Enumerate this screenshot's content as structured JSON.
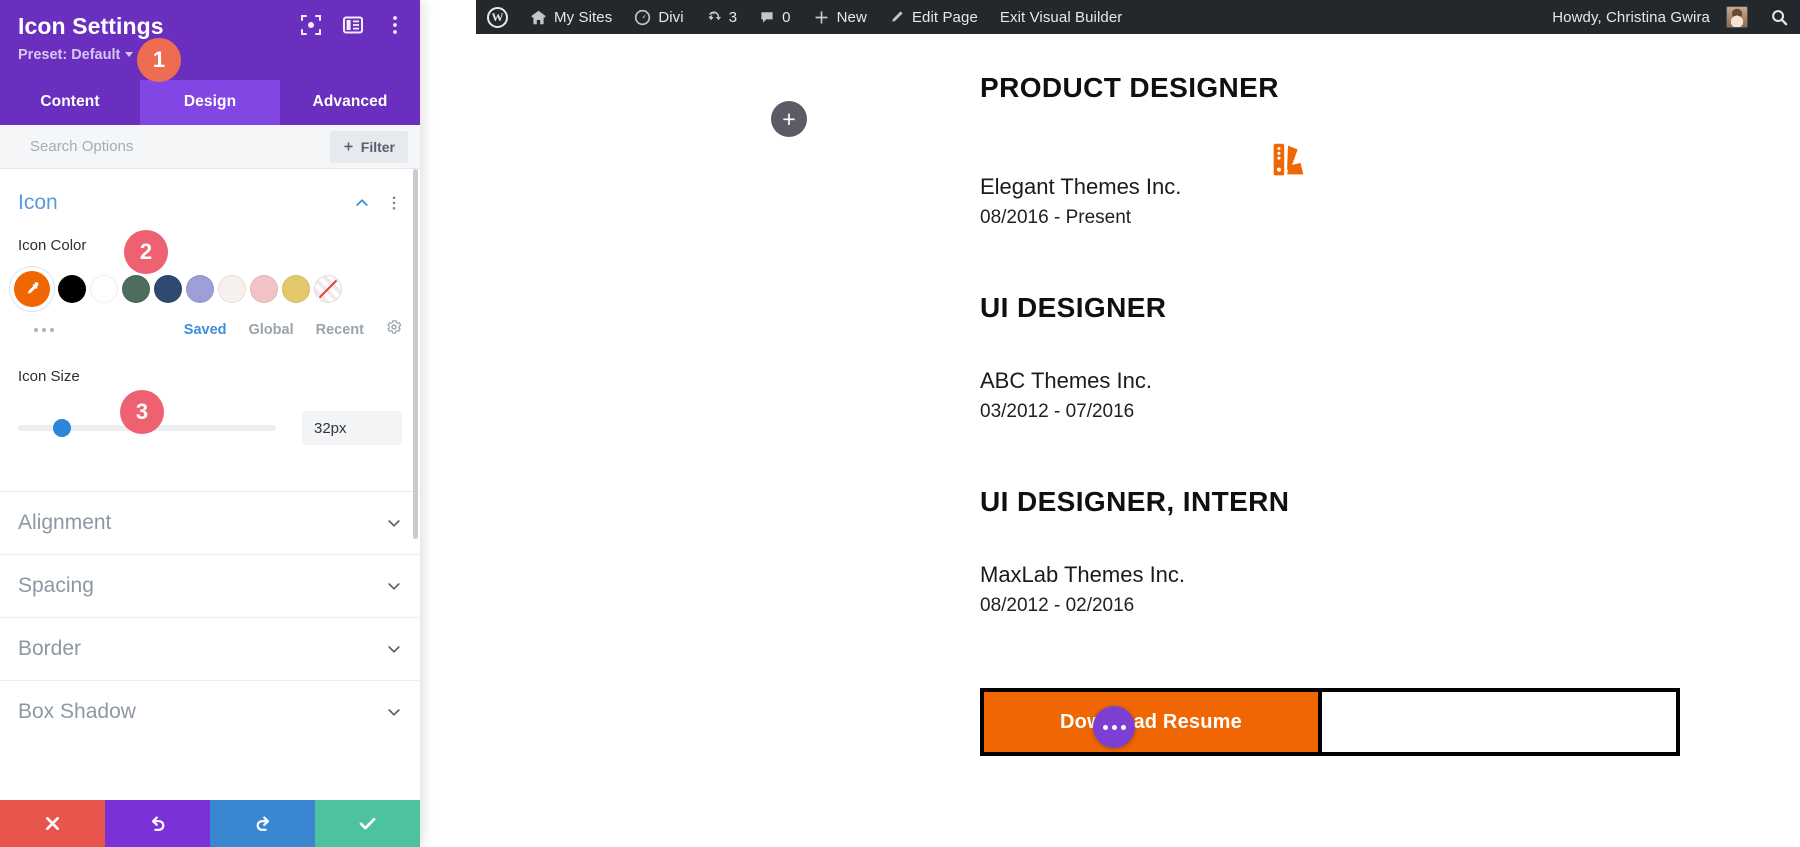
{
  "adminbar": {
    "items": [
      {
        "icon": "wordpress-logo-icon",
        "label": ""
      },
      {
        "icon": "my-sites-icon",
        "label": "My Sites"
      },
      {
        "icon": "dashboard-icon",
        "label": "Divi"
      },
      {
        "icon": "updates-icon",
        "label": "3"
      },
      {
        "icon": "comments-icon",
        "label": "0"
      },
      {
        "icon": "plus-icon",
        "label": "New"
      },
      {
        "icon": "pencil-icon",
        "label": "Edit Page"
      },
      {
        "icon": "",
        "label": "Exit Visual Builder"
      }
    ],
    "howdy": "Howdy, Christina Gwira",
    "search_icon": "search-icon"
  },
  "panel": {
    "title": "Icon Settings",
    "preset_label": "Preset: Default",
    "header_icons": [
      "expand-icon",
      "layout-toggle-icon",
      "kebab-menu-icon"
    ],
    "tabs": [
      {
        "label": "Content",
        "active": false
      },
      {
        "label": "Design",
        "active": true
      },
      {
        "label": "Advanced",
        "active": false
      }
    ],
    "search": {
      "placeholder": "Search Options",
      "filter_label": "Filter",
      "filter_icon": "plus-icon"
    },
    "sections": {
      "icon": {
        "title": "Icon",
        "collapse_icon": "chevron-up-icon",
        "kebab_icon": "kebab-menu-icon",
        "icon_color": {
          "label": "Icon Color",
          "selected_color": "#ef6603",
          "selected_icon": "eyedropper-icon",
          "swatches": [
            "#000000",
            "#ffffff",
            "#4e6e5d",
            "#2e4a70",
            "#9c9fd8",
            "#f6f1ef",
            "#f2c3c6",
            "#e3c96a"
          ],
          "no_color_label": "none",
          "more_icon": "ellipsis-icon",
          "links": [
            {
              "label": "Saved",
              "active": true
            },
            {
              "label": "Global",
              "active": false
            },
            {
              "label": "Recent",
              "active": false
            }
          ],
          "settings_icon": "gear-icon"
        },
        "icon_size": {
          "label": "Icon Size",
          "value": "32px",
          "slider_percent": 17
        }
      },
      "collapsed": [
        {
          "title": "Alignment",
          "chevron": "chevron-down-icon"
        },
        {
          "title": "Spacing",
          "chevron": "chevron-down-icon"
        },
        {
          "title": "Border",
          "chevron": "chevron-down-icon"
        },
        {
          "title": "Box Shadow",
          "chevron": "chevron-down-icon"
        }
      ]
    },
    "footer": [
      {
        "name": "cancel",
        "icon": "close-x-icon",
        "color": "#e8554d"
      },
      {
        "name": "undo",
        "icon": "undo-icon",
        "color": "#7b31d8"
      },
      {
        "name": "redo",
        "icon": "redo-icon",
        "color": "#3b86d1"
      },
      {
        "name": "save",
        "icon": "checkmark-icon",
        "color": "#4cc2a0"
      }
    ]
  },
  "tooltips": {
    "step1": "1",
    "step2": "2",
    "step3": "3"
  },
  "canvas": {
    "add_section_icon": "plus-icon",
    "palette_icon": "color-palette-icon",
    "palette_color": "#ef6603",
    "entries": [
      {
        "title": "PRODUCT DESIGNER",
        "company": "Elegant Themes Inc.",
        "dates": "08/2016 - Present"
      },
      {
        "title": "UI DESIGNER",
        "company": "ABC Themes Inc.",
        "dates": "03/2012 - 07/2016"
      },
      {
        "title": "UI DESIGNER, INTERN",
        "company": "MaxLab Themes Inc.",
        "dates": "08/2012 - 02/2016"
      }
    ],
    "download_button": {
      "label": "Download Resume",
      "bg": "#ef6603"
    },
    "module_dots_icon": "ellipsis-icon"
  }
}
